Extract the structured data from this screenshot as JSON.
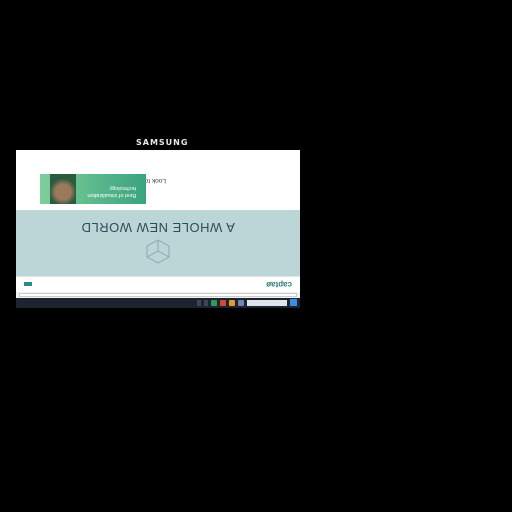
{
  "monitor": {
    "brand": "SAMSUNG"
  },
  "browser": {
    "url": ""
  },
  "site": {
    "logo": "captaø",
    "nav": [
      "",
      ""
    ],
    "cta": ""
  },
  "hero": {
    "title": "A WHOLE NEW WORLD"
  },
  "promo": {
    "title": "Look to the Future with Captae",
    "text": "",
    "card_caption": "Best of visualization technology"
  },
  "taskbar": {
    "tray_time": ""
  },
  "colors": {
    "hero_bg": "#bcd6d8",
    "accent": "#2e8a86",
    "taskbar": "#1d2430"
  }
}
